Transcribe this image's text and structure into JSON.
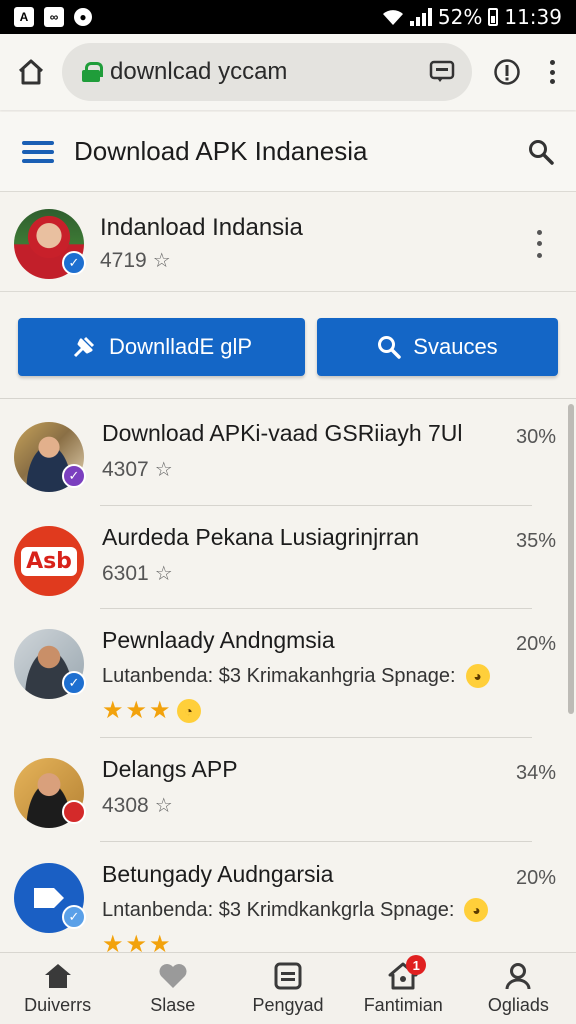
{
  "status_bar": {
    "battery": "52%",
    "time": "11:39"
  },
  "browser": {
    "url": "downlcad yccam"
  },
  "header": {
    "title": "Download APK Indanesia"
  },
  "profile": {
    "name": "Indanload Indansia",
    "count": "4719"
  },
  "buttons": {
    "download_label": "DownlladE glP",
    "search_label": "Svauces"
  },
  "list": [
    {
      "title": "Download APKi-vaad GSRiiayh 7Ul",
      "count": "4307",
      "percent": "30%"
    },
    {
      "title": "Aurdeda Pekana Lusiagrinjrran",
      "count": "6301",
      "percent": "35%",
      "logo_text": "Asb"
    },
    {
      "title": "Pewnlaady Andngmsia",
      "desc": "Lutanbenda: $3 Krimakanhgria Spnage:",
      "percent": "20%",
      "rating": 3
    },
    {
      "title": "Delangs APP",
      "count": "4308",
      "percent": "34%"
    },
    {
      "title": "Betungady Audngarsia",
      "desc": "Lntanbenda: $3 Krimdkankgrla Spnage:",
      "percent": "20%",
      "rating": 3
    }
  ],
  "bottom_nav": [
    {
      "label": "Duiverrs",
      "icon": "home-icon"
    },
    {
      "label": "Slase",
      "icon": "heart-icon"
    },
    {
      "label": "Pengyad",
      "icon": "document-icon"
    },
    {
      "label": "Fantimian",
      "icon": "notification-icon",
      "badge": "1"
    },
    {
      "label": "Ogliads",
      "icon": "profile-icon"
    }
  ],
  "colors": {
    "accent": "#1466c6",
    "secure": "#1f9d3a",
    "star": "#f2a20c"
  }
}
